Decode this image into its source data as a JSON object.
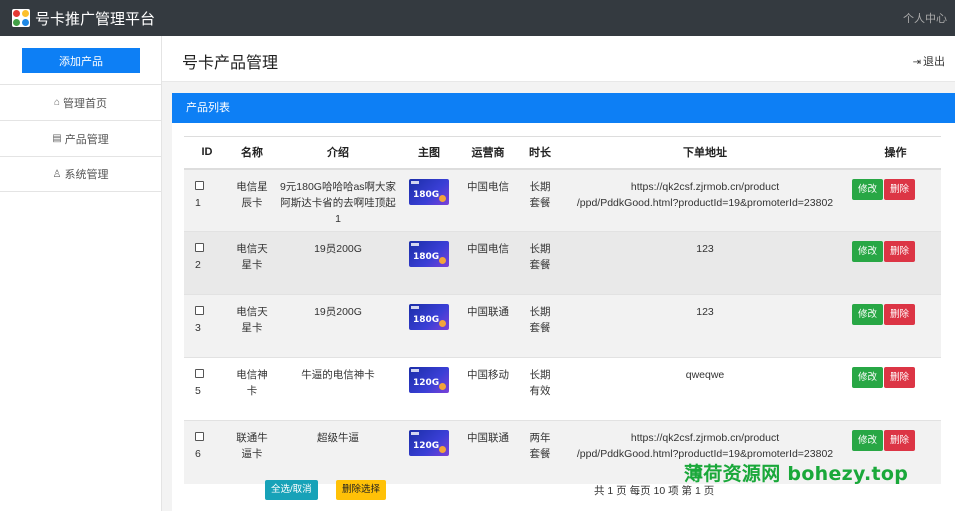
{
  "app": {
    "title": "号卡推广管理平台",
    "user_center": "个人中心"
  },
  "sidebar": {
    "add_button": "添加产品",
    "items": [
      {
        "icon": "home-icon",
        "label": "管理首页"
      },
      {
        "icon": "document-icon",
        "label": "产品管理"
      },
      {
        "icon": "user-icon",
        "label": "系统管理"
      }
    ]
  },
  "header": {
    "title": "号卡产品管理",
    "logout": "退出"
  },
  "panel": {
    "title": "产品列表"
  },
  "table": {
    "columns": [
      "ID",
      "名称",
      "介绍",
      "主图",
      "运营商",
      "时长",
      "下单地址",
      "操作"
    ],
    "edit_label": "修改",
    "delete_label": "删除",
    "rows": [
      {
        "id": "1",
        "name": "电信星辰卡",
        "intro": "9元180G哈哈哈as啊大家阿斯达卡省的去啊哇顶起1",
        "image_text": "180G",
        "carrier": "中国电信",
        "duration": "长期套餐",
        "url": "https://qk2csf.zjrmob.cn/product/ppd/PddkGood.html?productId=19&promoterId=23802"
      },
      {
        "id": "2",
        "name": "电信天星卡",
        "intro": "19员200G",
        "image_text": "180G",
        "carrier": "中国电信",
        "duration": "长期套餐",
        "url": "123"
      },
      {
        "id": "3",
        "name": "电信天星卡",
        "intro": "19员200G",
        "image_text": "180G",
        "carrier": "中国联通",
        "duration": "长期套餐",
        "url": "123"
      },
      {
        "id": "5",
        "name": "电信神卡",
        "intro": "牛逼的电信神卡",
        "image_text": "120G",
        "carrier": "中国移动",
        "duration": "长期有效",
        "url": "qweqwe"
      },
      {
        "id": "6",
        "name": "联通牛逼卡",
        "intro": "超级牛逼",
        "image_text": "120G",
        "carrier": "中国联通",
        "duration": "两年套餐",
        "url": "https://qk2csf.zjrmob.cn/product/ppd/PddkGood.html?productId=19&promoterId=23802"
      }
    ]
  },
  "footer": {
    "select_all": "全选/取消",
    "delete_selected": "删除选择",
    "pager": "共 1 页  每页 10 项   第 1 页"
  },
  "watermark": "薄荷资源网 bohezy.top",
  "colors": {
    "primary": "#0d7ff5",
    "topbar": "#343a40",
    "edit": "#28a745",
    "delete": "#dc3545",
    "info": "#17a2b8",
    "warning": "#ffc107",
    "watermark": "#1aa83a"
  }
}
